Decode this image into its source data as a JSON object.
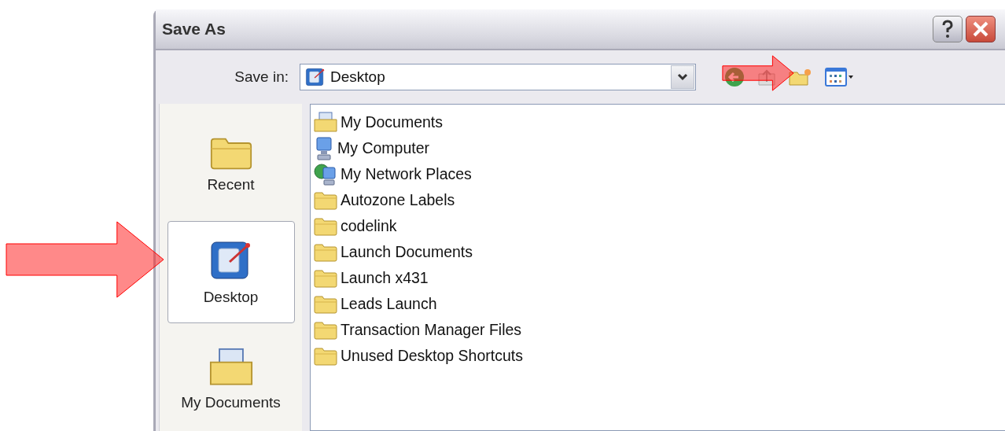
{
  "window": {
    "title": "Save As"
  },
  "toolbar": {
    "save_in_label": "Save in:",
    "location": "Desktop"
  },
  "places": [
    {
      "label": "Recent",
      "kind": "recent",
      "selected": false
    },
    {
      "label": "Desktop",
      "kind": "desktop",
      "selected": true
    },
    {
      "label": "My Documents",
      "kind": "documents",
      "selected": false
    }
  ],
  "files": [
    {
      "name": "My Documents",
      "kind": "documents"
    },
    {
      "name": "My Computer",
      "kind": "computer"
    },
    {
      "name": "My Network Places",
      "kind": "network"
    },
    {
      "name": "Autozone Labels",
      "kind": "folder"
    },
    {
      "name": "codelink",
      "kind": "folder"
    },
    {
      "name": "Launch Documents",
      "kind": "folder"
    },
    {
      "name": "Launch x431",
      "kind": "folder"
    },
    {
      "name": "Leads Launch",
      "kind": "folder"
    },
    {
      "name": "Transaction Manager Files",
      "kind": "folder"
    },
    {
      "name": "Unused Desktop Shortcuts",
      "kind": "folder"
    }
  ]
}
